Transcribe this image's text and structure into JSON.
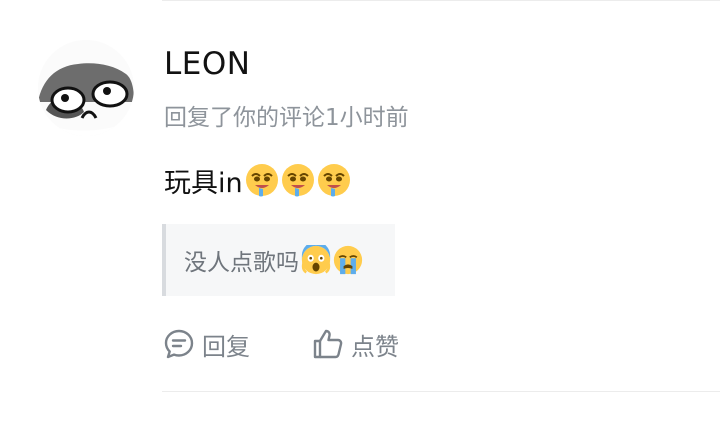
{
  "comment": {
    "username": "LEON",
    "action_text": "回复了你的评论",
    "time_ago": "1小时前",
    "content_text": "玩具in",
    "content_emojis": [
      "drooling-emoji",
      "drooling-emoji",
      "drooling-emoji"
    ],
    "quoted_text": "没人点歌吗",
    "quoted_emojis": [
      "screaming-emoji",
      "crying-emoji"
    ]
  },
  "actions": {
    "reply_label": "回复",
    "like_label": "点赞"
  },
  "colors": {
    "username": "#121212",
    "meta": "#8e949b",
    "action": "#7c838b",
    "quote_background": "#f6f7f8",
    "quote_border": "#d8dbdf"
  }
}
